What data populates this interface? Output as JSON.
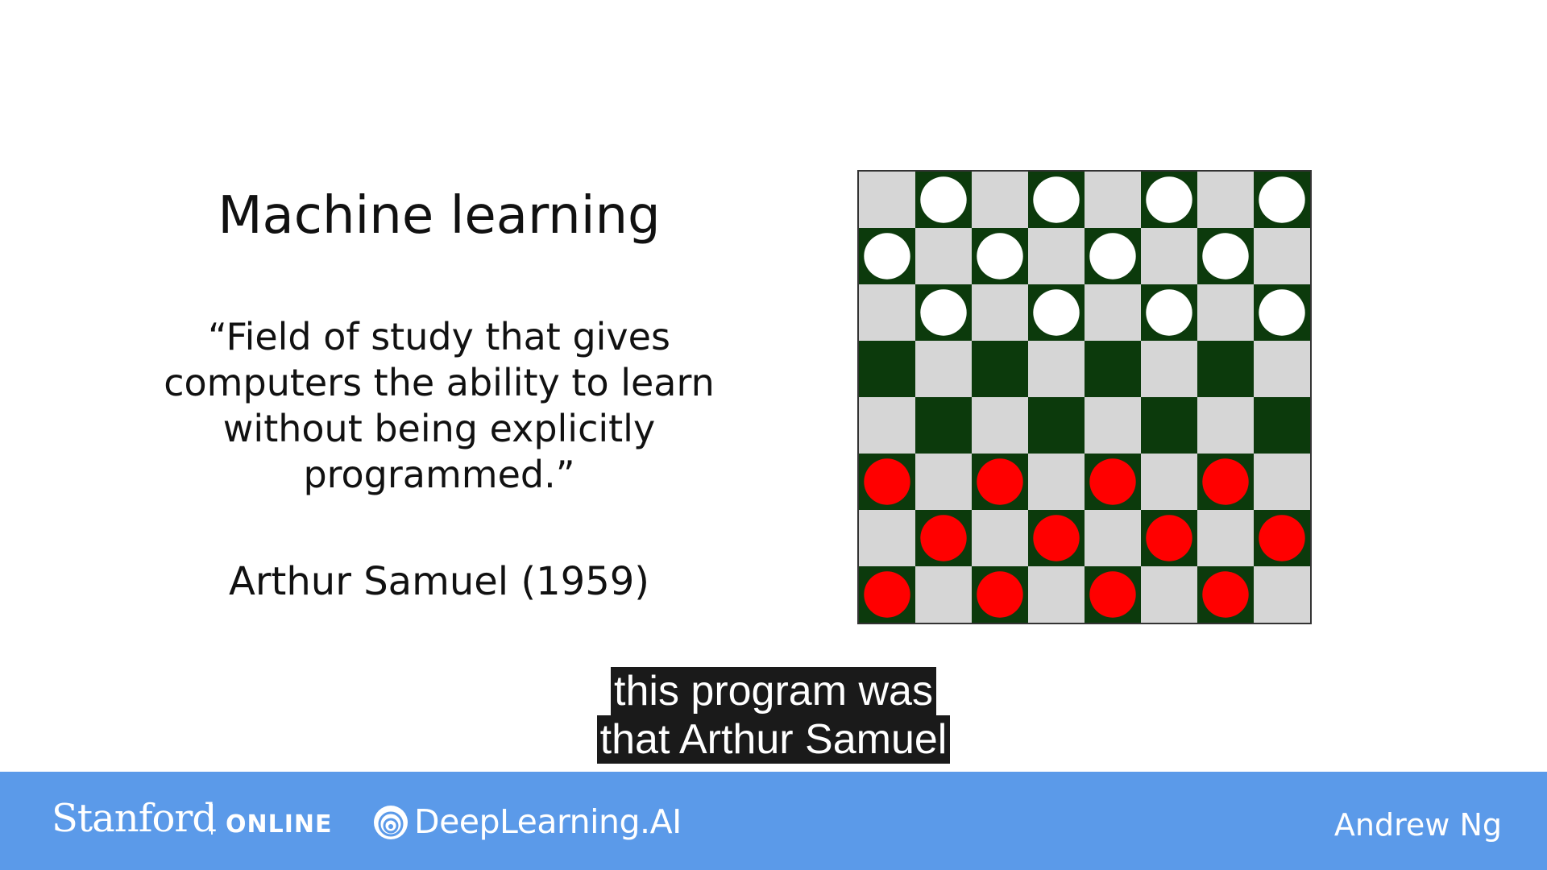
{
  "slide": {
    "title": "Machine learning",
    "quote_lines": [
      "“Field of study that gives",
      "computers the ability to learn",
      "without being explicitly",
      "programmed.”"
    ],
    "attribution": "Arthur Samuel (1959)"
  },
  "board": {
    "rows": 8,
    "cols": 8,
    "colors": {
      "dark_square": "#0c3a0c",
      "light_square": "#d6d6d6",
      "white_piece": "#ffffff",
      "red_piece": "#ff0000"
    },
    "pieces": [
      {
        "row": 0,
        "col": 1,
        "color": "white"
      },
      {
        "row": 0,
        "col": 3,
        "color": "white"
      },
      {
        "row": 0,
        "col": 5,
        "color": "white"
      },
      {
        "row": 0,
        "col": 7,
        "color": "white"
      },
      {
        "row": 1,
        "col": 0,
        "color": "white"
      },
      {
        "row": 1,
        "col": 2,
        "color": "white"
      },
      {
        "row": 1,
        "col": 4,
        "color": "white"
      },
      {
        "row": 1,
        "col": 6,
        "color": "white"
      },
      {
        "row": 2,
        "col": 1,
        "color": "white"
      },
      {
        "row": 2,
        "col": 3,
        "color": "white"
      },
      {
        "row": 2,
        "col": 5,
        "color": "white"
      },
      {
        "row": 2,
        "col": 7,
        "color": "white"
      },
      {
        "row": 5,
        "col": 0,
        "color": "red"
      },
      {
        "row": 5,
        "col": 2,
        "color": "red"
      },
      {
        "row": 5,
        "col": 4,
        "color": "red"
      },
      {
        "row": 5,
        "col": 6,
        "color": "red"
      },
      {
        "row": 6,
        "col": 1,
        "color": "red"
      },
      {
        "row": 6,
        "col": 3,
        "color": "red"
      },
      {
        "row": 6,
        "col": 5,
        "color": "red"
      },
      {
        "row": 6,
        "col": 7,
        "color": "red"
      },
      {
        "row": 7,
        "col": 0,
        "color": "red"
      },
      {
        "row": 7,
        "col": 2,
        "color": "red"
      },
      {
        "row": 7,
        "col": 4,
        "color": "red"
      },
      {
        "row": 7,
        "col": 6,
        "color": "red"
      }
    ]
  },
  "captions": {
    "lines": [
      "this program was",
      "that Arthur Samuel"
    ]
  },
  "footer": {
    "stanford": "Stanford",
    "online": "ONLINE",
    "deeplearning": "DeepLearning.AI",
    "deeplearning_icon": "deeplearning-logo-icon",
    "presenter": "Andrew Ng",
    "background": "#5b9ae9"
  }
}
